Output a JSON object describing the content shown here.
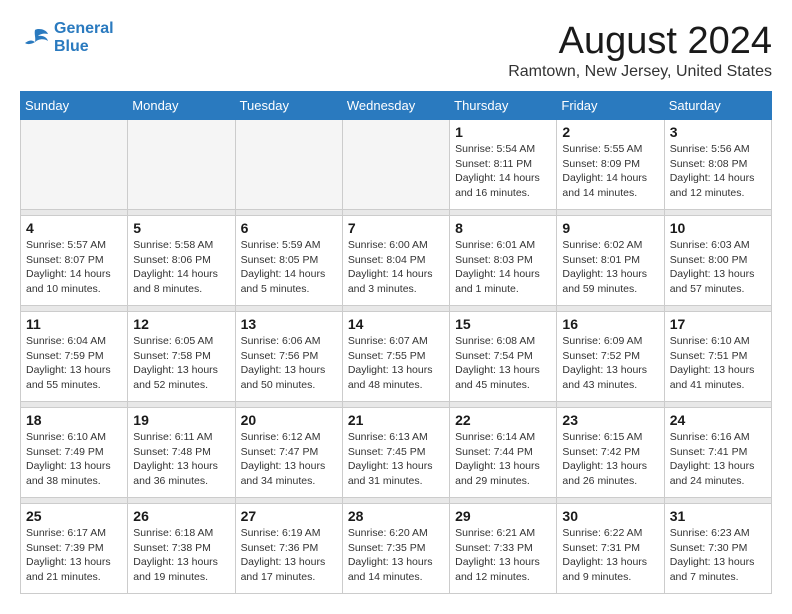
{
  "logo": {
    "line1": "General",
    "line2": "Blue"
  },
  "title": "August 2024",
  "location": "Ramtown, New Jersey, United States",
  "weekdays": [
    "Sunday",
    "Monday",
    "Tuesday",
    "Wednesday",
    "Thursday",
    "Friday",
    "Saturday"
  ],
  "weeks": [
    [
      {
        "day": "",
        "info": ""
      },
      {
        "day": "",
        "info": ""
      },
      {
        "day": "",
        "info": ""
      },
      {
        "day": "",
        "info": ""
      },
      {
        "day": "1",
        "info": "Sunrise: 5:54 AM\nSunset: 8:11 PM\nDaylight: 14 hours\nand 16 minutes."
      },
      {
        "day": "2",
        "info": "Sunrise: 5:55 AM\nSunset: 8:09 PM\nDaylight: 14 hours\nand 14 minutes."
      },
      {
        "day": "3",
        "info": "Sunrise: 5:56 AM\nSunset: 8:08 PM\nDaylight: 14 hours\nand 12 minutes."
      }
    ],
    [
      {
        "day": "4",
        "info": "Sunrise: 5:57 AM\nSunset: 8:07 PM\nDaylight: 14 hours\nand 10 minutes."
      },
      {
        "day": "5",
        "info": "Sunrise: 5:58 AM\nSunset: 8:06 PM\nDaylight: 14 hours\nand 8 minutes."
      },
      {
        "day": "6",
        "info": "Sunrise: 5:59 AM\nSunset: 8:05 PM\nDaylight: 14 hours\nand 5 minutes."
      },
      {
        "day": "7",
        "info": "Sunrise: 6:00 AM\nSunset: 8:04 PM\nDaylight: 14 hours\nand 3 minutes."
      },
      {
        "day": "8",
        "info": "Sunrise: 6:01 AM\nSunset: 8:03 PM\nDaylight: 14 hours\nand 1 minute."
      },
      {
        "day": "9",
        "info": "Sunrise: 6:02 AM\nSunset: 8:01 PM\nDaylight: 13 hours\nand 59 minutes."
      },
      {
        "day": "10",
        "info": "Sunrise: 6:03 AM\nSunset: 8:00 PM\nDaylight: 13 hours\nand 57 minutes."
      }
    ],
    [
      {
        "day": "11",
        "info": "Sunrise: 6:04 AM\nSunset: 7:59 PM\nDaylight: 13 hours\nand 55 minutes."
      },
      {
        "day": "12",
        "info": "Sunrise: 6:05 AM\nSunset: 7:58 PM\nDaylight: 13 hours\nand 52 minutes."
      },
      {
        "day": "13",
        "info": "Sunrise: 6:06 AM\nSunset: 7:56 PM\nDaylight: 13 hours\nand 50 minutes."
      },
      {
        "day": "14",
        "info": "Sunrise: 6:07 AM\nSunset: 7:55 PM\nDaylight: 13 hours\nand 48 minutes."
      },
      {
        "day": "15",
        "info": "Sunrise: 6:08 AM\nSunset: 7:54 PM\nDaylight: 13 hours\nand 45 minutes."
      },
      {
        "day": "16",
        "info": "Sunrise: 6:09 AM\nSunset: 7:52 PM\nDaylight: 13 hours\nand 43 minutes."
      },
      {
        "day": "17",
        "info": "Sunrise: 6:10 AM\nSunset: 7:51 PM\nDaylight: 13 hours\nand 41 minutes."
      }
    ],
    [
      {
        "day": "18",
        "info": "Sunrise: 6:10 AM\nSunset: 7:49 PM\nDaylight: 13 hours\nand 38 minutes."
      },
      {
        "day": "19",
        "info": "Sunrise: 6:11 AM\nSunset: 7:48 PM\nDaylight: 13 hours\nand 36 minutes."
      },
      {
        "day": "20",
        "info": "Sunrise: 6:12 AM\nSunset: 7:47 PM\nDaylight: 13 hours\nand 34 minutes."
      },
      {
        "day": "21",
        "info": "Sunrise: 6:13 AM\nSunset: 7:45 PM\nDaylight: 13 hours\nand 31 minutes."
      },
      {
        "day": "22",
        "info": "Sunrise: 6:14 AM\nSunset: 7:44 PM\nDaylight: 13 hours\nand 29 minutes."
      },
      {
        "day": "23",
        "info": "Sunrise: 6:15 AM\nSunset: 7:42 PM\nDaylight: 13 hours\nand 26 minutes."
      },
      {
        "day": "24",
        "info": "Sunrise: 6:16 AM\nSunset: 7:41 PM\nDaylight: 13 hours\nand 24 minutes."
      }
    ],
    [
      {
        "day": "25",
        "info": "Sunrise: 6:17 AM\nSunset: 7:39 PM\nDaylight: 13 hours\nand 21 minutes."
      },
      {
        "day": "26",
        "info": "Sunrise: 6:18 AM\nSunset: 7:38 PM\nDaylight: 13 hours\nand 19 minutes."
      },
      {
        "day": "27",
        "info": "Sunrise: 6:19 AM\nSunset: 7:36 PM\nDaylight: 13 hours\nand 17 minutes."
      },
      {
        "day": "28",
        "info": "Sunrise: 6:20 AM\nSunset: 7:35 PM\nDaylight: 13 hours\nand 14 minutes."
      },
      {
        "day": "29",
        "info": "Sunrise: 6:21 AM\nSunset: 7:33 PM\nDaylight: 13 hours\nand 12 minutes."
      },
      {
        "day": "30",
        "info": "Sunrise: 6:22 AM\nSunset: 7:31 PM\nDaylight: 13 hours\nand 9 minutes."
      },
      {
        "day": "31",
        "info": "Sunrise: 6:23 AM\nSunset: 7:30 PM\nDaylight: 13 hours\nand 7 minutes."
      }
    ]
  ]
}
